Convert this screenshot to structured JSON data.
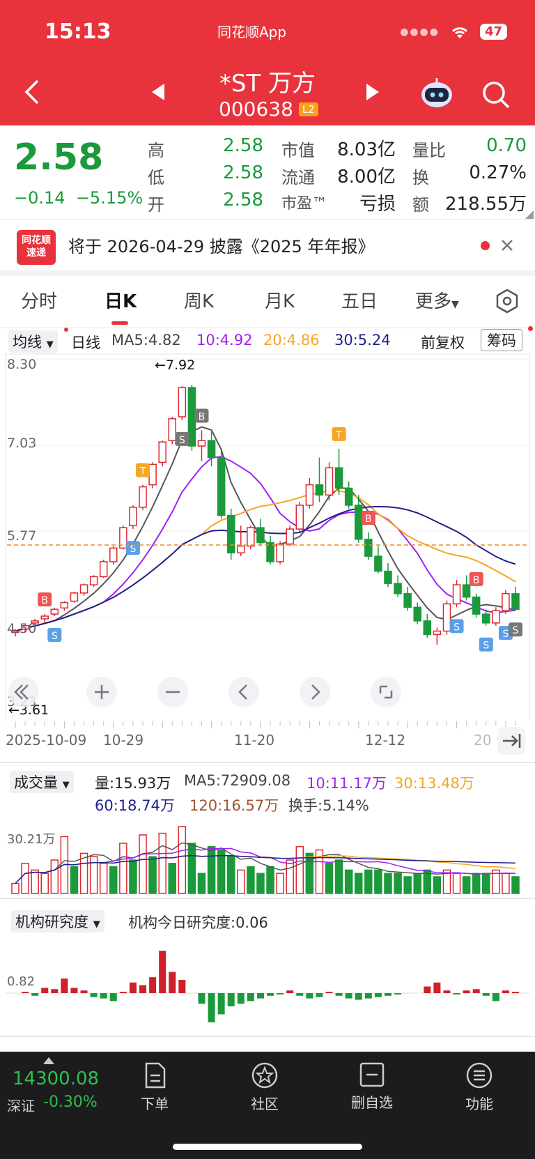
{
  "status": {
    "time": "15:13",
    "app": "同花顺App",
    "battery": "47"
  },
  "nav": {
    "title": "*ST 万方",
    "code": "000638",
    "level": "L2"
  },
  "quote": {
    "price": "2.58",
    "change": "−0.14",
    "change_pct": "−5.15%",
    "high_label": "高",
    "high": "2.58",
    "low_label": "低",
    "low": "2.58",
    "open_label": "开",
    "open": "2.58",
    "mcap_label": "市值",
    "mcap": "8.03亿",
    "float_label": "流通",
    "float": "8.00亿",
    "pe_label": "市盈™",
    "pe": "亏损",
    "vol_ratio_label": "量比",
    "vol_ratio": "0.70",
    "turnover_label": "换",
    "turnover": "0.27%",
    "amount_label": "额",
    "amount": "218.55万"
  },
  "notice": {
    "logo_line1": "同花顺",
    "logo_line2": "速递",
    "text": "将于 2026-04-29 披露《2025 年年报》"
  },
  "tabs": [
    "分时",
    "日K",
    "周K",
    "月K",
    "五日",
    "更多"
  ],
  "active_tab": "日K",
  "kline": {
    "ma_select": "均线",
    "period": "日线",
    "ma5": "MA5:4.82",
    "ma10": "10:4.92",
    "ma20": "20:4.86",
    "ma30": "30:5.24",
    "adjust": "前复权",
    "chips": "筹码",
    "y_labels": [
      "8.30",
      "7.03",
      "5.77",
      "4.50",
      "3.23"
    ],
    "high_mark": "←7.92",
    "low_mark": "←3.61",
    "x_labels": [
      "2025-10-09",
      "10-29",
      "11-20",
      "12-12",
      "20"
    ]
  },
  "volume": {
    "select": "成交量",
    "vol": "量:15.93万",
    "ma5": "MA5:72909.08",
    "ma10": "10:11.17万",
    "ma30": "30:13.48万",
    "ma60": "60:18.74万",
    "ma120": "120:16.57万",
    "turnover": "换手:5.14%",
    "y_label": "30.21万"
  },
  "research": {
    "select": "机构研究度",
    "today": "机构今日研究度:0.06",
    "y_label": "0.82"
  },
  "bottom": {
    "index_value": "14300.08",
    "index_name": "深证",
    "index_change": "-0.30%",
    "items": [
      "下单",
      "社区",
      "删自选",
      "功能"
    ]
  },
  "colors": {
    "up": "#e0262f",
    "down": "#1a9a3a",
    "brand": "#e8323c",
    "ma5": "#555555",
    "ma10": "#a020f0",
    "ma20": "#f5a623",
    "ma30": "#1f1f8f"
  },
  "chart_data": [
    {
      "type": "candlestick",
      "title": "日K",
      "ylim": [
        3.23,
        8.3
      ],
      "x_labels": [
        "2025-10-09",
        "10-29",
        "11-20",
        "12-12"
      ],
      "candles": [
        [
          4.28,
          4.33,
          4.22,
          4.3
        ],
        [
          4.33,
          4.4,
          4.28,
          4.38
        ],
        [
          4.42,
          4.48,
          4.36,
          4.45
        ],
        [
          4.48,
          4.55,
          4.42,
          4.52
        ],
        [
          4.55,
          4.64,
          4.52,
          4.62
        ],
        [
          4.64,
          4.74,
          4.6,
          4.72
        ],
        [
          4.74,
          4.88,
          4.72,
          4.86
        ],
        [
          4.86,
          5.0,
          4.82,
          4.98
        ],
        [
          4.98,
          5.12,
          4.95,
          5.1
        ],
        [
          5.1,
          5.35,
          5.08,
          5.32
        ],
        [
          5.32,
          5.55,
          5.28,
          5.52
        ],
        [
          5.52,
          5.85,
          5.5,
          5.82
        ],
        [
          5.85,
          6.15,
          5.8,
          6.12
        ],
        [
          6.12,
          6.45,
          6.08,
          6.42
        ],
        [
          6.45,
          6.78,
          6.4,
          6.75
        ],
        [
          6.78,
          7.1,
          6.72,
          7.08
        ],
        [
          7.1,
          7.45,
          7.05,
          7.42
        ],
        [
          7.45,
          7.9,
          7.4,
          7.88
        ],
        [
          7.88,
          7.92,
          6.95,
          7.02
        ],
        [
          7.02,
          7.25,
          6.8,
          7.1
        ],
        [
          7.1,
          7.25,
          6.72,
          6.85
        ],
        [
          6.85,
          6.95,
          5.95,
          6.0
        ],
        [
          6.0,
          6.1,
          5.35,
          5.45
        ],
        [
          5.45,
          5.85,
          5.4,
          5.55
        ],
        [
          5.55,
          5.85,
          5.5,
          5.82
        ],
        [
          5.82,
          5.95,
          5.55,
          5.6
        ],
        [
          5.6,
          5.7,
          5.28,
          5.32
        ],
        [
          5.32,
          5.62,
          5.28,
          5.58
        ],
        [
          5.58,
          5.85,
          5.55,
          5.8
        ],
        [
          5.8,
          6.2,
          5.75,
          6.15
        ],
        [
          6.15,
          6.55,
          6.1,
          6.45
        ],
        [
          6.45,
          6.85,
          6.2,
          6.3
        ],
        [
          6.3,
          6.78,
          6.22,
          6.7
        ],
        [
          6.7,
          6.98,
          6.3,
          6.4
        ],
        [
          6.4,
          6.5,
          6.1,
          6.15
        ],
        [
          6.15,
          6.3,
          5.6,
          5.65
        ],
        [
          5.65,
          5.75,
          5.35,
          5.4
        ],
        [
          5.4,
          5.55,
          5.15,
          5.18
        ],
        [
          5.18,
          5.3,
          4.95,
          5.0
        ],
        [
          5.0,
          5.12,
          4.8,
          4.85
        ],
        [
          4.85,
          4.95,
          4.6,
          4.65
        ],
        [
          4.65,
          4.72,
          4.4,
          4.45
        ],
        [
          4.45,
          4.55,
          4.2,
          4.25
        ],
        [
          4.25,
          4.35,
          4.1,
          4.3
        ],
        [
          4.3,
          4.75,
          4.25,
          4.7
        ],
        [
          4.7,
          5.05,
          4.65,
          4.98
        ],
        [
          4.98,
          5.12,
          4.75,
          4.8
        ],
        [
          4.8,
          4.85,
          4.5,
          4.55
        ],
        [
          4.55,
          4.62,
          4.38,
          4.42
        ],
        [
          4.42,
          4.65,
          4.38,
          4.6
        ],
        [
          4.6,
          4.9,
          4.55,
          4.85
        ],
        [
          4.85,
          4.95,
          4.6,
          4.62
        ]
      ]
    },
    {
      "type": "bar",
      "title": "成交量",
      "ylim": [
        0,
        45
      ],
      "up": [
        true,
        true,
        true,
        true,
        true,
        true,
        false,
        true,
        true,
        true,
        false,
        true,
        false,
        true,
        false,
        true,
        false,
        true,
        false,
        false,
        false,
        false,
        false,
        true,
        false,
        false,
        false,
        true,
        true,
        true,
        false,
        true,
        false,
        false,
        false,
        false,
        false,
        false,
        false,
        false,
        false,
        false,
        false,
        false,
        true,
        true,
        false,
        false,
        false,
        true,
        true,
        false
      ],
      "values": [
        6,
        18,
        14,
        12,
        20,
        34,
        16,
        24,
        22,
        18,
        16,
        30,
        20,
        35,
        22,
        36,
        18,
        40,
        30,
        12,
        28,
        26,
        22,
        14,
        16,
        12,
        16,
        12,
        20,
        28,
        24,
        26,
        18,
        20,
        14,
        12,
        14,
        14,
        12,
        12,
        10,
        12,
        14,
        10,
        14,
        12,
        10,
        12,
        12,
        14,
        12,
        10
      ]
    },
    {
      "type": "bar",
      "title": "机构研究度",
      "values": [
        0.0,
        0.05,
        -0.1,
        0.2,
        0.15,
        0.55,
        0.2,
        0.1,
        -0.15,
        -0.2,
        -0.3,
        0.05,
        0.4,
        0.3,
        0.6,
        1.6,
        0.8,
        0.5,
        0.0,
        -0.4,
        -1.1,
        -0.8,
        -0.5,
        -0.4,
        -0.3,
        -0.2,
        -0.1,
        -0.05,
        0.1,
        -0.1,
        -0.2,
        -0.15,
        0.05,
        -0.1,
        -0.2,
        -0.25,
        -0.2,
        -0.15,
        -0.1,
        -0.05,
        0.0,
        0.0,
        0.25,
        0.4,
        0.1,
        -0.05,
        0.1,
        0.15,
        -0.1,
        -0.3,
        0.1,
        0.05
      ]
    }
  ]
}
